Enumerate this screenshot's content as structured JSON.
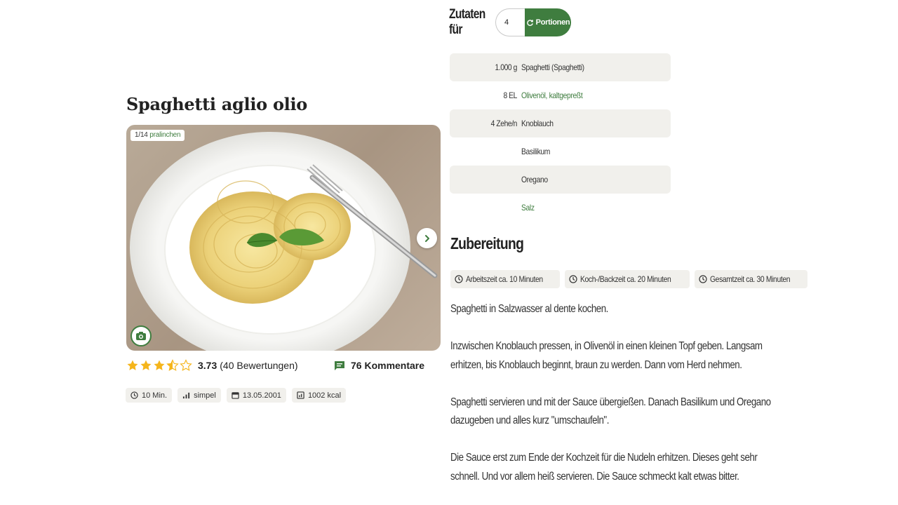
{
  "recipe": {
    "title": "Spaghetti aglio olio",
    "photo_counter": "1/14",
    "photo_author": "pralinchen",
    "rating_value": "3.73",
    "rating_count": "(40 Bewertungen)",
    "rating_stars": 3.5,
    "comments": "76 Kommentare",
    "meta": [
      {
        "icon": "clock-icon",
        "label": "10 Min."
      },
      {
        "icon": "difficulty-icon",
        "label": "simpel"
      },
      {
        "icon": "calendar-icon",
        "label": "13.05.2001"
      },
      {
        "icon": "kcal-icon",
        "label": "1002 kcal"
      }
    ]
  },
  "ingredients_header": {
    "label": "Zutaten für",
    "portions_value": "4",
    "portions_button": "Portionen"
  },
  "ingredients": [
    {
      "amount": "1.000 g",
      "name": "Spaghetti (Spaghetti)",
      "link": false
    },
    {
      "amount": "8 EL",
      "name": "Olivenöl, kaltgepreßt",
      "link": true
    },
    {
      "amount": "4 Zehe/n",
      "name": "Knoblauch",
      "link": false
    },
    {
      "amount": "",
      "name": "Basilikum",
      "link": false
    },
    {
      "amount": "",
      "name": "Oregano",
      "link": false
    },
    {
      "amount": "",
      "name": "Salz",
      "link": true
    }
  ],
  "preparation": {
    "title": "Zubereitung",
    "times": [
      "Arbeitszeit ca. 10 Minuten",
      "Koch-/Backzeit ca. 20 Minuten",
      "Gesamtzeit ca. 30 Minuten"
    ],
    "steps": [
      "Spaghetti in Salzwasser al dente kochen.",
      "Inzwischen Knoblauch pressen, in Olivenöl in einen kleinen Topf geben. Langsam erhitzen, bis Knoblauch beginnt, braun zu werden. Dann vom Herd nehmen.",
      "Spaghetti servieren und mit der Sauce übergießen. Danach Basilikum und Oregano dazugeben und alles kurz \"umschaufeln\".",
      "Die Sauce erst zum Ende der Kochzeit für die Nudeln erhitzen. Dieses geht sehr schnell. Und vor allem heiß servieren. Die Sauce schmeckt kalt etwas bitter."
    ]
  },
  "colors": {
    "brand_green": "#3f7d3f",
    "star": "#f5b51b",
    "chip_bg": "#f1f0ec"
  }
}
